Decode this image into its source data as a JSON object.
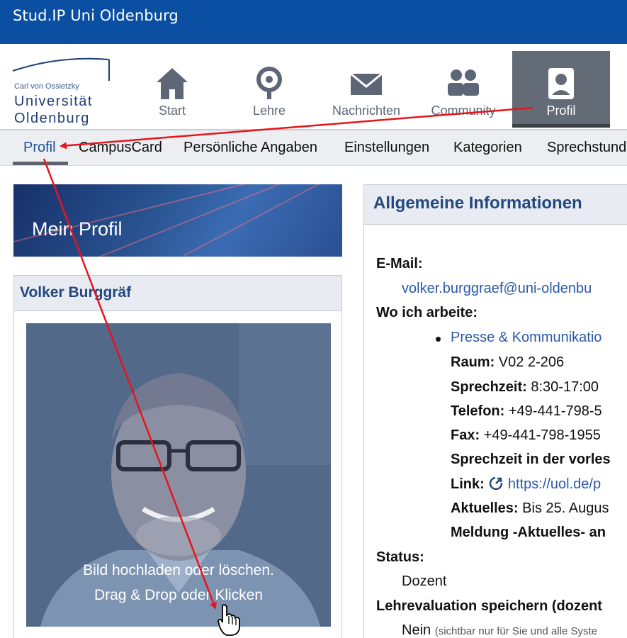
{
  "window": {
    "title": "Stud.IP Uni Oldenburg"
  },
  "logo": {
    "line1": "Carl von Ossietzky",
    "line2": "Universität",
    "line3": "Oldenburg"
  },
  "mainnav": {
    "items": [
      {
        "label": "Start",
        "icon": "home-icon"
      },
      {
        "label": "Lehre",
        "icon": "seminar-icon"
      },
      {
        "label": "Nachrichten",
        "icon": "mail-icon"
      },
      {
        "label": "Community",
        "icon": "community-icon"
      },
      {
        "label": "Profil",
        "icon": "profile-icon",
        "active": true
      }
    ]
  },
  "subnav": {
    "items": [
      "Profil",
      "CampusCard",
      "Persönliche Angaben",
      "Einstellungen",
      "Kategorien",
      "Sprechstund"
    ],
    "active": "Profil"
  },
  "banner": {
    "title": "Mein Profil"
  },
  "profile": {
    "name": "Volker Burggräf",
    "upload_line1": "Bild hochladen oder löschen.",
    "upload_line2": "Drag & Drop oder Klicken"
  },
  "info": {
    "title": "Allgemeine Informationen",
    "email_label": "E-Mail:",
    "email_value": "volker.burggraef@uni-oldenbu",
    "work_label": "Wo ich arbeite:",
    "institute": "Presse & Kommunikatio",
    "room_label": "Raum:",
    "room_value": "V02 2-206",
    "hours_label": "Sprechzeit:",
    "hours_value": "8:30-17:00",
    "phone_label": "Telefon:",
    "phone_value": "+49-441-798-5",
    "fax_label": "Fax:",
    "fax_value": "+49-441-798-1955",
    "lecturefree_label": "Sprechzeit in der vorles",
    "link_label": "Link:",
    "link_value": "https://uol.de/p",
    "news_label": "Aktuelles:",
    "news_value": "Bis 25. Augus",
    "report_label": "Meldung -Aktuelles- an",
    "status_label": "Status:",
    "status_value": "Dozent",
    "eval_label": "Lehrevaluation speichern (dozent",
    "eval_value": "Nein",
    "eval_note": "(sichtbar nur für Sie und alle Syste"
  },
  "colors": {
    "titlebar": "#0b4fa2",
    "nav_active": "#636b76",
    "link": "#2a5aa6",
    "annotation": "#e8141c"
  }
}
